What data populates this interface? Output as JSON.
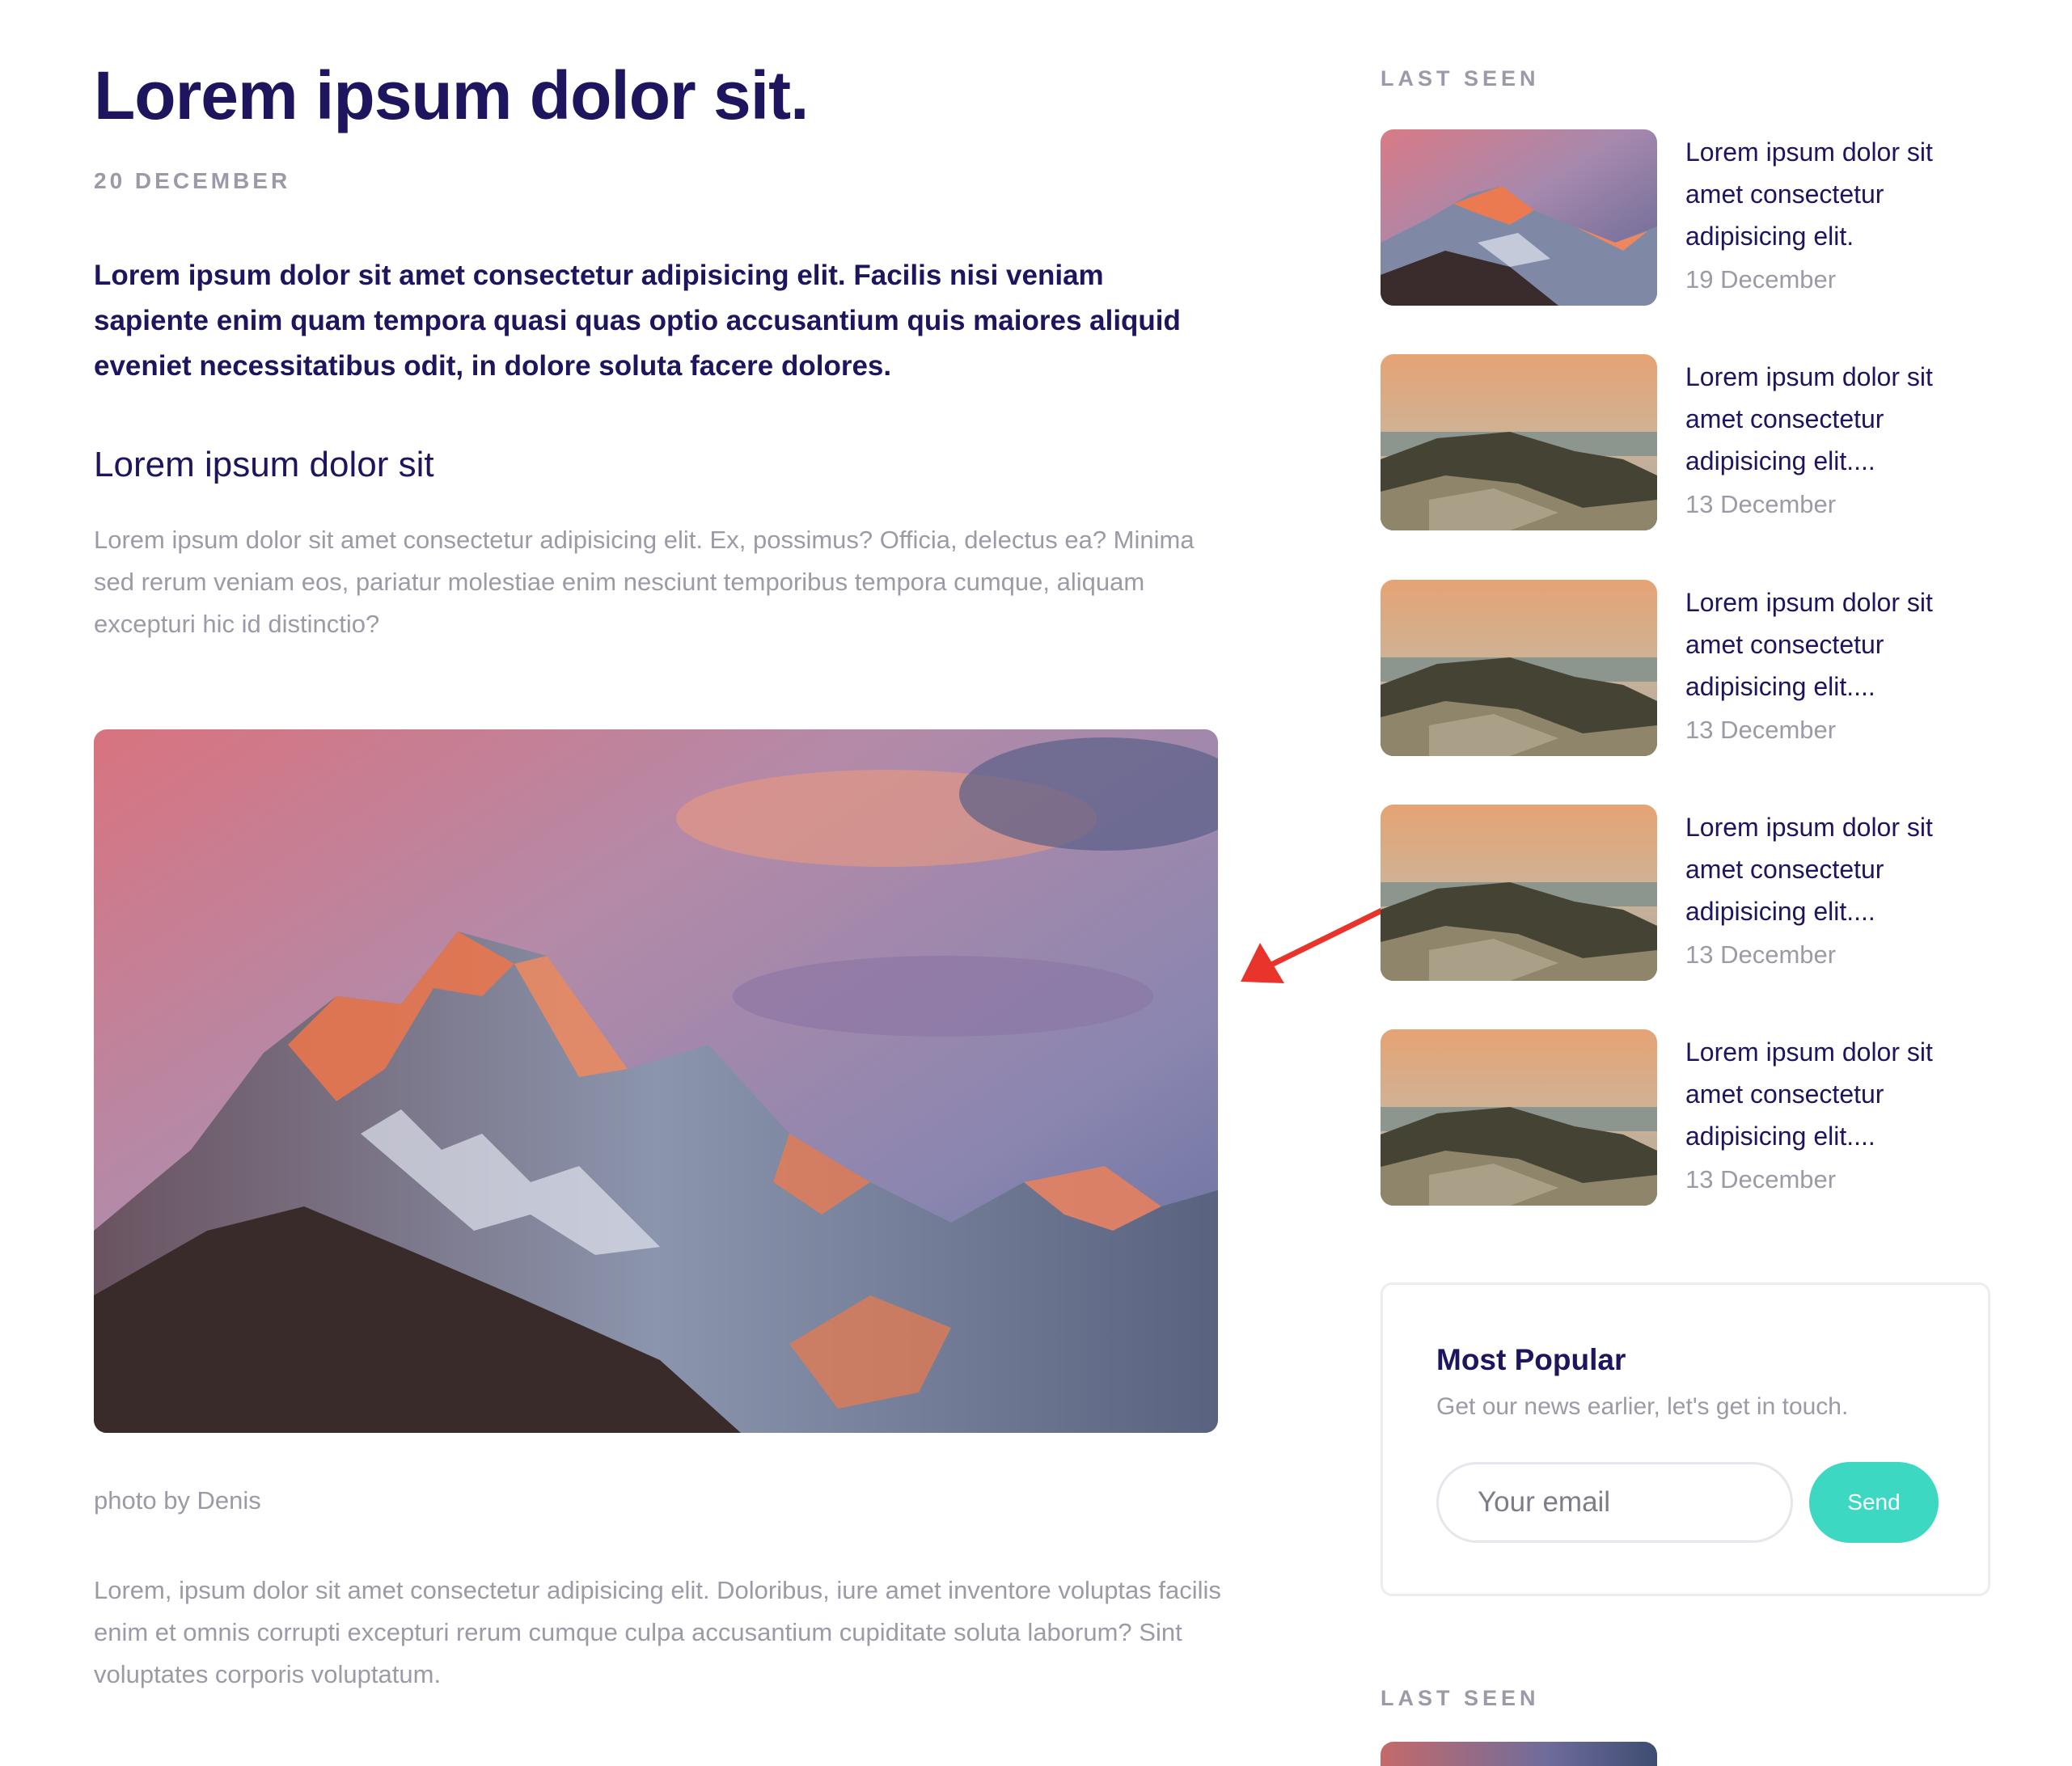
{
  "article": {
    "title": "Lorem ipsum dolor sit.",
    "date": "20 DECEMBER",
    "lead": "Lorem ipsum dolor sit amet consectetur adipisicing elit. Facilis nisi veniam sapiente enim quam tempora quasi quas optio accusantium quis maiores aliquid eveniet necessitatibus odit, in dolore soluta facere dolores.",
    "subheading": "Lorem ipsum dolor sit",
    "paragraph_1": "Lorem ipsum dolor sit amet consectetur adipisicing elit. Ex, possimus? Officia, delectus ea? Minima sed rerum veniam eos, pariatur molestiae enim nesciunt temporibus tempora cumque, aliquam excepturi hic id distinctio?",
    "hero_image": "mountain-sunset-photo",
    "caption": "photo by Denis",
    "paragraph_2": "Lorem, ipsum dolor sit amet consectetur adipisicing elit. Doloribus, iure amet inventore voluptas facilis enim et omnis corrupti excepturi rerum cumque culpa accusantium cupiditate soluta laborum? Sint voluptates corporis voluptatum."
  },
  "annotation": {
    "icon": "red-arrow-icon",
    "color": "#e8342a"
  },
  "sidebar": {
    "last_seen_label": "LAST SEEN",
    "last_seen_items": [
      {
        "title": "Lorem ipsum dolor sit amet consectetur adipisicing elit.",
        "date": "19 December",
        "thumbnail": "mountain-thumbnail"
      },
      {
        "title": "Lorem ipsum dolor sit amet consectetur adipisicing elit....",
        "date": "13 December",
        "thumbnail": "rocky-shore-thumbnail"
      },
      {
        "title": "Lorem ipsum dolor sit amet consectetur adipisicing elit....",
        "date": "13 December",
        "thumbnail": "rocky-shore-thumbnail"
      },
      {
        "title": "Lorem ipsum dolor sit amet consectetur adipisicing elit....",
        "date": "13 December",
        "thumbnail": "rocky-shore-thumbnail"
      },
      {
        "title": "Lorem ipsum dolor sit amet consectetur adipisicing elit....",
        "date": "13 December",
        "thumbnail": "rocky-shore-thumbnail"
      }
    ],
    "popular": {
      "title": "Most Popular",
      "subtitle": "Get our news earlier, let's get in touch.",
      "email_placeholder": "Your email",
      "email_value": "",
      "send_label": "Send"
    },
    "last_seen_label_2": "LAST SEEN"
  },
  "colors": {
    "heading": "#1d155e",
    "muted": "#9b9ba7",
    "accent": "#3dd8c1"
  }
}
